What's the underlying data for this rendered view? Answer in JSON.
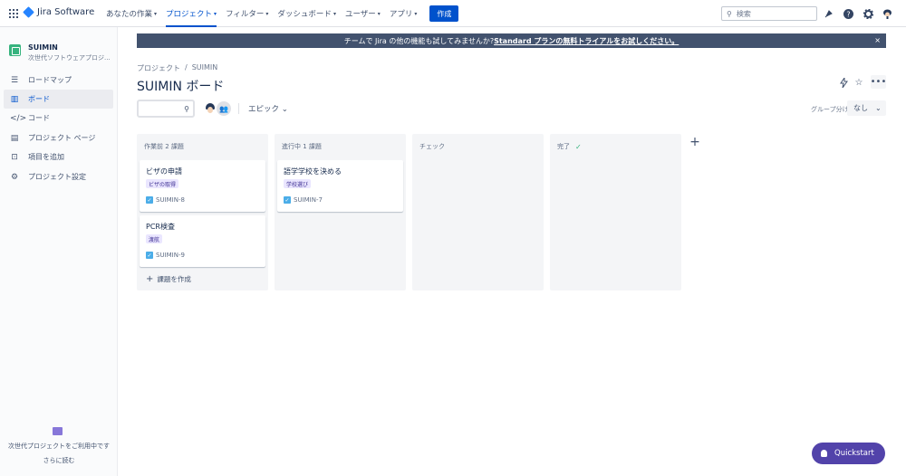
{
  "topnav": {
    "logo_text": "Jira Software",
    "items": [
      {
        "label": "あなたの作業"
      },
      {
        "label": "プロジェクト"
      },
      {
        "label": "フィルター"
      },
      {
        "label": "ダッシュボード"
      },
      {
        "label": "ユーザー"
      },
      {
        "label": "アプリ"
      }
    ],
    "create_label": "作成",
    "search_placeholder": "検索"
  },
  "sidebar": {
    "project_name": "SUIMIN",
    "project_type": "次世代ソフトウェアプロジ...",
    "items": [
      {
        "label": "ロードマップ",
        "icon": "roadmap-icon"
      },
      {
        "label": "ボード",
        "icon": "board-icon"
      },
      {
        "label": "コード",
        "icon": "code-icon"
      },
      {
        "label": "プロジェクト ページ",
        "icon": "page-icon"
      },
      {
        "label": "項目を追加",
        "icon": "add-item-icon"
      },
      {
        "label": "プロジェクト設定",
        "icon": "settings-icon"
      }
    ],
    "footer_text": "次世代プロジェクトをご利用中です",
    "footer_link": "さらに読む"
  },
  "banner": {
    "prefix": "チームで Jira の他の機能も試してみませんか? ",
    "link": "Standard プランの無料トライアルをお試しください。",
    "close": "×"
  },
  "header": {
    "breadcrumb": [
      "プロジェクト",
      "SUIMIN"
    ],
    "breadcrumb_sep": "/",
    "title": "SUIMIN ボード"
  },
  "toolbar": {
    "epic_label": "エピック",
    "group_label": "グループ分け",
    "group_value": "なし"
  },
  "columns": [
    {
      "title": "作業前 2 課題",
      "done": false,
      "cards": [
        {
          "title": "ビザの申請",
          "epic": "ビザの取得",
          "key": "SUIMIN-8"
        },
        {
          "title": "PCR検査",
          "epic": "渡航",
          "key": "SUIMIN-9"
        }
      ],
      "create_label": "課題を作成"
    },
    {
      "title": "進行中 1 課題",
      "done": false,
      "cards": [
        {
          "title": "語学学校を決める",
          "epic": "学校選び",
          "key": "SUIMIN-7"
        }
      ]
    },
    {
      "title": "チェック",
      "done": false,
      "cards": []
    },
    {
      "title": "完了",
      "done": true,
      "cards": []
    }
  ],
  "quickstart_label": "Quickstart",
  "colors": {
    "primary": "#0052CC",
    "banner": "#42526E",
    "epic_bg": "#EAE6FF",
    "quickstart": "#5243AA"
  }
}
